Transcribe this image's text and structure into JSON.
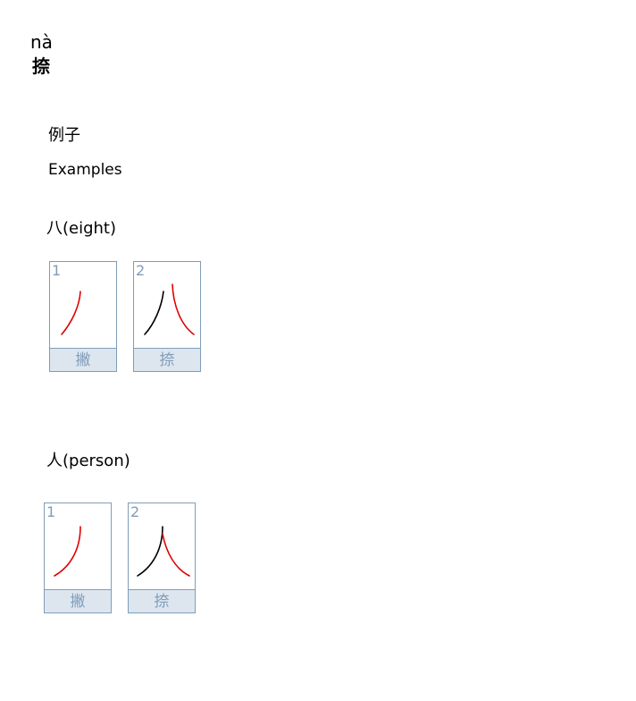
{
  "header": {
    "pinyin": "nà",
    "character": "捺"
  },
  "examples": {
    "heading_cn": "例子",
    "heading_en": "Examples",
    "items": [
      {
        "word": "八(eight)",
        "cards": [
          {
            "number": "1",
            "stroke_name": "撇"
          },
          {
            "number": "2",
            "stroke_name": "捺"
          }
        ]
      },
      {
        "word": "人(person)",
        "cards": [
          {
            "number": "1",
            "stroke_name": "撇"
          },
          {
            "number": "2",
            "stroke_name": "捺"
          }
        ]
      }
    ]
  },
  "colors": {
    "highlight_stroke": "#e00000",
    "previous_stroke": "#000000",
    "card_border": "#7f9db9",
    "card_label_bg": "#dde6ef"
  }
}
